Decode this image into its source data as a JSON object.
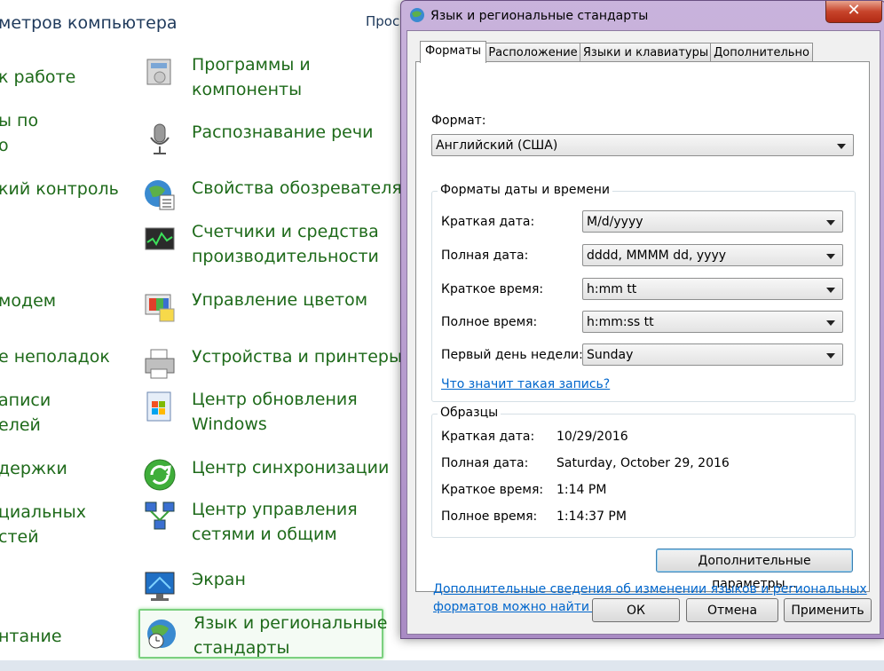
{
  "control_panel": {
    "title": "метров компьютера",
    "top_right": "Прос",
    "left_links": [
      "к работе",
      "ы по\nо",
      "кий контроль",
      "модем",
      "е неполадок",
      "аписи\nелей",
      "держки",
      "циальных\nстей",
      "нтание"
    ],
    "items": [
      {
        "label": "Программы и\nкомпоненты",
        "icon": "programs-icon"
      },
      {
        "label": "Распознавание речи",
        "icon": "microphone-icon"
      },
      {
        "label": "Свойства обозревателя",
        "icon": "internet-options-icon"
      },
      {
        "label": "Счетчики и средства\nпроизводительности",
        "icon": "performance-icon"
      },
      {
        "label": "Управление цветом",
        "icon": "color-management-icon"
      },
      {
        "label": "Устройства и принтеры",
        "icon": "printer-icon"
      },
      {
        "label": "Центр обновления\nWindows",
        "icon": "windows-update-icon"
      },
      {
        "label": "Центр синхронизации",
        "icon": "sync-icon"
      },
      {
        "label": "Центр управления\nсетями и общим",
        "icon": "network-icon"
      },
      {
        "label": "Экран",
        "icon": "display-icon"
      },
      {
        "label": "Язык и региональные\nстандарты",
        "icon": "region-icon"
      }
    ]
  },
  "dialog": {
    "title": "Язык и региональные стандарты",
    "close": "✕",
    "tabs": [
      "Форматы",
      "Расположение",
      "Языки и клавиатуры",
      "Дополнительно"
    ],
    "format_label": "Формат:",
    "format_value": "Английский (США)",
    "datetime_group": "Форматы даты и времени",
    "fields": [
      {
        "label": "Краткая дата:",
        "value": "M/d/yyyy"
      },
      {
        "label": "Полная дата:",
        "value": "dddd, MMMM dd, yyyy"
      },
      {
        "label": "Краткое время:",
        "value": "h:mm tt"
      },
      {
        "label": "Полное время:",
        "value": "h:mm:ss tt"
      },
      {
        "label": "Первый день недели:",
        "value": "Sunday"
      }
    ],
    "what_link": "Что значит такая запись?",
    "samples_group": "Образцы",
    "samples": [
      {
        "label": "Краткая дата:",
        "value": "10/29/2016"
      },
      {
        "label": "Полная дата:",
        "value": "Saturday, October 29, 2016"
      },
      {
        "label": "Краткое время:",
        "value": "1:14 PM"
      },
      {
        "label": "Полное время:",
        "value": "1:14:37 PM"
      }
    ],
    "advanced_button": "Дополнительные параметры...",
    "info_link_line1": "Дополнительные сведения об изменении языков и региональных",
    "info_link_line2": "форматов можно найти в Интернете",
    "ok": "ОК",
    "cancel": "Отмена",
    "apply": "Применить"
  }
}
